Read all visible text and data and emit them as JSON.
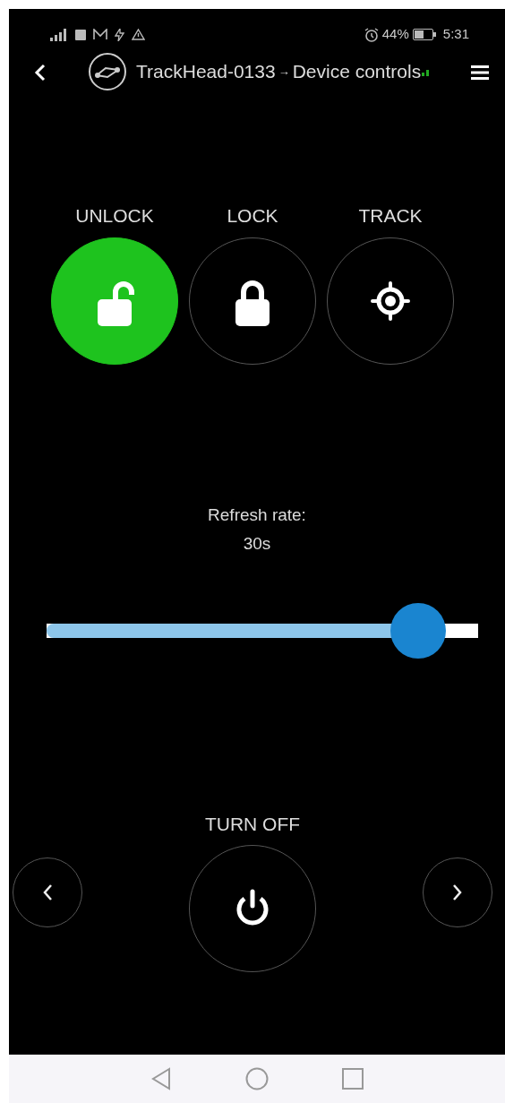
{
  "status_bar": {
    "battery": "44%",
    "time": "5:31"
  },
  "header": {
    "device": "TrackHead-0133",
    "arrow": "→",
    "page": "Device controls"
  },
  "actions": [
    {
      "label": "UNLOCK",
      "kind": "unlock",
      "selected": true
    },
    {
      "label": "LOCK",
      "kind": "lock",
      "selected": false
    },
    {
      "label": "TRACK",
      "kind": "track",
      "selected": false
    }
  ],
  "refresh": {
    "label": "Refresh rate:",
    "reading": "30s",
    "level": 0.86
  },
  "power": {
    "label": "TURN OFF"
  }
}
